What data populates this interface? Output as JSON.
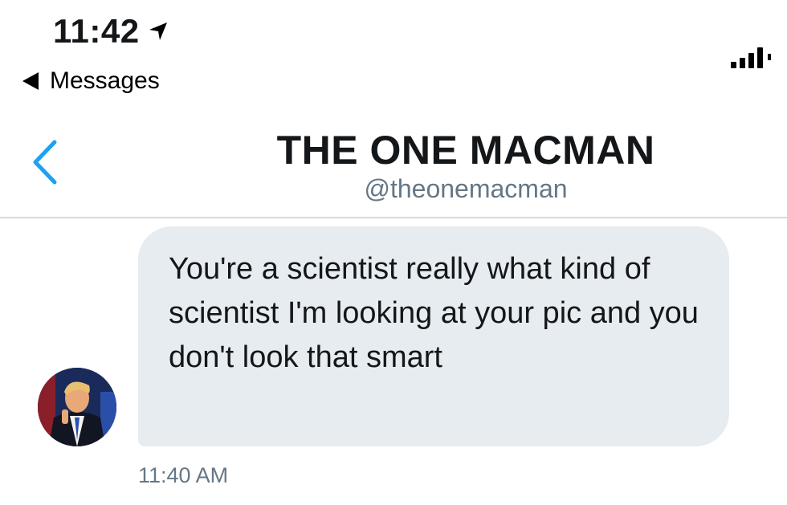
{
  "status_bar": {
    "time": "11:42",
    "back_to_app_label": "Messages",
    "signal_bars": 4
  },
  "header": {
    "title": "THE ONE MACMAN",
    "handle": "@theonemacman"
  },
  "conversation": {
    "messages": [
      {
        "text": "You're a scientist really what kind of scientist I'm looking at your pic and you don't look that smart",
        "timestamp": "11:40 AM",
        "direction": "incoming"
      }
    ]
  },
  "colors": {
    "accent": "#1da1f2",
    "bubble_bg": "#e6ecf0",
    "secondary_text": "#657786"
  },
  "icons": {
    "location": "location-arrow-icon",
    "back_app": "back-triangle-icon",
    "signal": "signal-icon",
    "nav_back": "chevron-left-icon"
  }
}
